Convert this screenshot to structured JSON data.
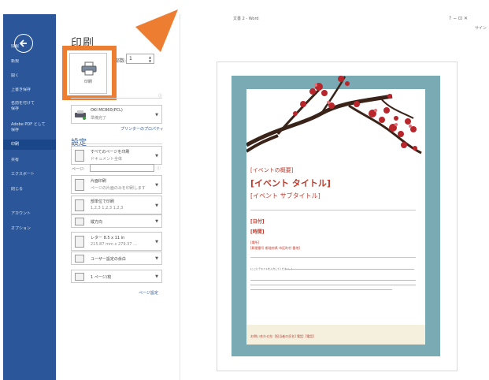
{
  "backstage": {
    "nav_items": [
      {
        "label": "情報",
        "active": false
      },
      {
        "label": "新規",
        "active": false
      },
      {
        "label": "開く",
        "active": false
      },
      {
        "label": "上書き保存",
        "active": false
      },
      {
        "label": "名前を付けて",
        "active": false
      },
      {
        "label": "保存",
        "active": false
      },
      {
        "label": "Adobe PDF として",
        "active": false
      },
      {
        "label": "保存",
        "active": false
      },
      {
        "label": "印刷",
        "active": true
      },
      {
        "label": "共有",
        "active": false
      },
      {
        "label": "エクスポート",
        "active": false
      },
      {
        "label": "閉じる",
        "active": false
      },
      {
        "label": "アカウント",
        "active": false
      },
      {
        "label": "オプション",
        "active": false
      }
    ]
  },
  "print": {
    "title": "印刷",
    "print_button_label": "印刷",
    "copies_label": "部数:",
    "copies_value": "1",
    "printer_name": "OKI MC860(PCL)",
    "printer_status": "準備完了",
    "printer_properties_link": "プリンターのプロパティ",
    "settings_title": "設定",
    "settings": [
      {
        "line1": "すべてのページを印刷",
        "line2": "ドキュメント全体"
      },
      {
        "line1": "片面印刷",
        "line2": "ページの片面のみを印刷します"
      },
      {
        "line1": "部単位で印刷",
        "line2": "1,2,3   1,2,3   1,2,3"
      },
      {
        "line1": "縦方向",
        "line2": ""
      },
      {
        "line1": "レター 8.5 x 11 in",
        "line2": "215.87 mm x 279.37 ..."
      },
      {
        "line1": "ユーザー設定の余白",
        "line2": ""
      },
      {
        "line1": "1 ページ/枚",
        "line2": ""
      }
    ],
    "pages_label": "ページ:",
    "page_setup_link": "ページ設定"
  },
  "window": {
    "doc_title": "文書 2 - Word",
    "controls": "?  −  ⊡  ✕",
    "signin": "サイン"
  },
  "flyer": {
    "event_summary": "[イベントの概要]",
    "event_title": "[イベント タイトル]",
    "event_subtitle": "[イベント サブタイトル]",
    "date": "[日付]",
    "time": "[時間]",
    "location_label": "[場所]",
    "address": "[郵便番号 都道府県 市区町村 番地]",
    "body_line1": "[ここにテキストを入力してください。]",
    "footer": "お問い合わせ先: [担当者の氏名] 電話: [電話]"
  },
  "colors": {
    "rail": "#2b579a",
    "accent_orange": "#ed7d31",
    "flyer_border": "#7aabb5",
    "flyer_red": "#c0392b"
  }
}
